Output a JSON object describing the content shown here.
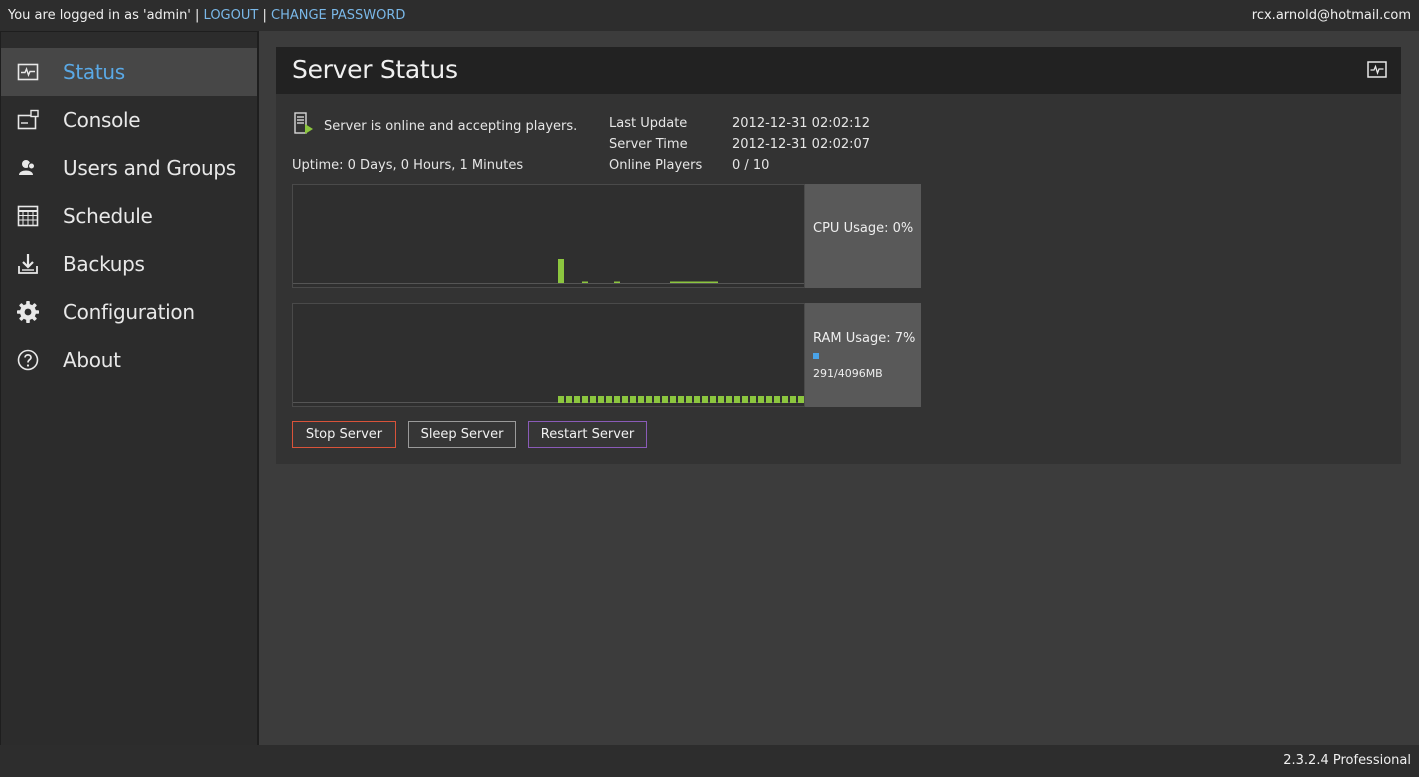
{
  "topbar": {
    "login_prefix": "You are logged in as 'admin' |",
    "logout": "LOGOUT",
    "separator": "|",
    "change_password": "CHANGE PASSWORD",
    "user_email": "rcx.arnold@hotmail.com",
    "link_color": "#7ab8e8"
  },
  "sidebar": {
    "accent_color": "#5aa9e6",
    "items": [
      {
        "label": "Status",
        "icon": "pulse-monitor-icon",
        "active": true
      },
      {
        "label": "Console",
        "icon": "console-icon",
        "active": false
      },
      {
        "label": "Users and Groups",
        "icon": "users-icon",
        "active": false
      },
      {
        "label": "Schedule",
        "icon": "calendar-grid-icon",
        "active": false
      },
      {
        "label": "Backups",
        "icon": "download-tray-icon",
        "active": false
      },
      {
        "label": "Configuration",
        "icon": "gear-icon",
        "active": false
      },
      {
        "label": "About",
        "icon": "question-circle-icon",
        "active": false
      }
    ]
  },
  "panel": {
    "title": "Server Status",
    "status_text": "Server is online and accepting players.",
    "uptime": "Uptime: 0 Days, 0 Hours, 1 Minutes",
    "info": [
      {
        "label": "Last Update",
        "value": "2012-12-31 02:02:12"
      },
      {
        "label": "Server Time",
        "value": "2012-12-31 02:02:07"
      },
      {
        "label": "Online Players",
        "value": "0 / 10"
      }
    ],
    "cpu": {
      "label": "CPU Usage: 0%",
      "bar_color": "#8cc63f"
    },
    "ram": {
      "label": "RAM Usage: 7%",
      "detail": "291/4096MB",
      "dot_color": "#4aa3e8",
      "bar_color": "#8cc63f"
    },
    "buttons": {
      "stop": "Stop Server",
      "sleep": "Sleep Server",
      "restart": "Restart Server"
    }
  },
  "footer": {
    "version": "2.3.2.4 Professional"
  }
}
